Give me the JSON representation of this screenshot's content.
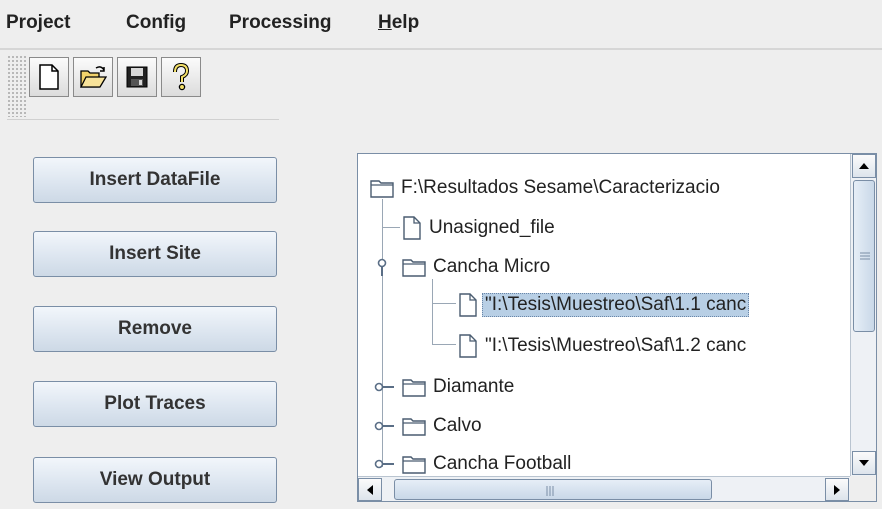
{
  "menu": {
    "items": [
      {
        "label": "Project"
      },
      {
        "label": "Config"
      },
      {
        "label": "Processing"
      },
      {
        "mnemonic": "H",
        "rest": "elp"
      }
    ]
  },
  "toolbar": {
    "buttons": [
      {
        "icon": "new-file-icon"
      },
      {
        "icon": "open-folder-icon"
      },
      {
        "icon": "save-disk-icon"
      },
      {
        "icon": "help-question-icon"
      }
    ]
  },
  "actions": {
    "insert_datafile": "Insert DataFile",
    "insert_site": "Insert Site",
    "remove": "Remove",
    "plot_traces": "Plot Traces",
    "view_output": "View Output"
  },
  "tree": {
    "root": "F:\\Resultados Sesame\\Caracterizacio",
    "unassigned": "Unasigned_file",
    "site_micro": "Cancha Micro",
    "file_1": "\"I:\\Tesis\\Muestreo\\Saf\\1.1 canc",
    "file_2": "\"I:\\Tesis\\Muestreo\\Saf\\1.2 canc",
    "site_diamante": "Diamante",
    "site_calvo": "Calvo",
    "site_football": "Cancha Football"
  },
  "colors": {
    "selection": "#b8cfe5",
    "button_border": "#7a8ea6",
    "background": "#eeeeee"
  }
}
